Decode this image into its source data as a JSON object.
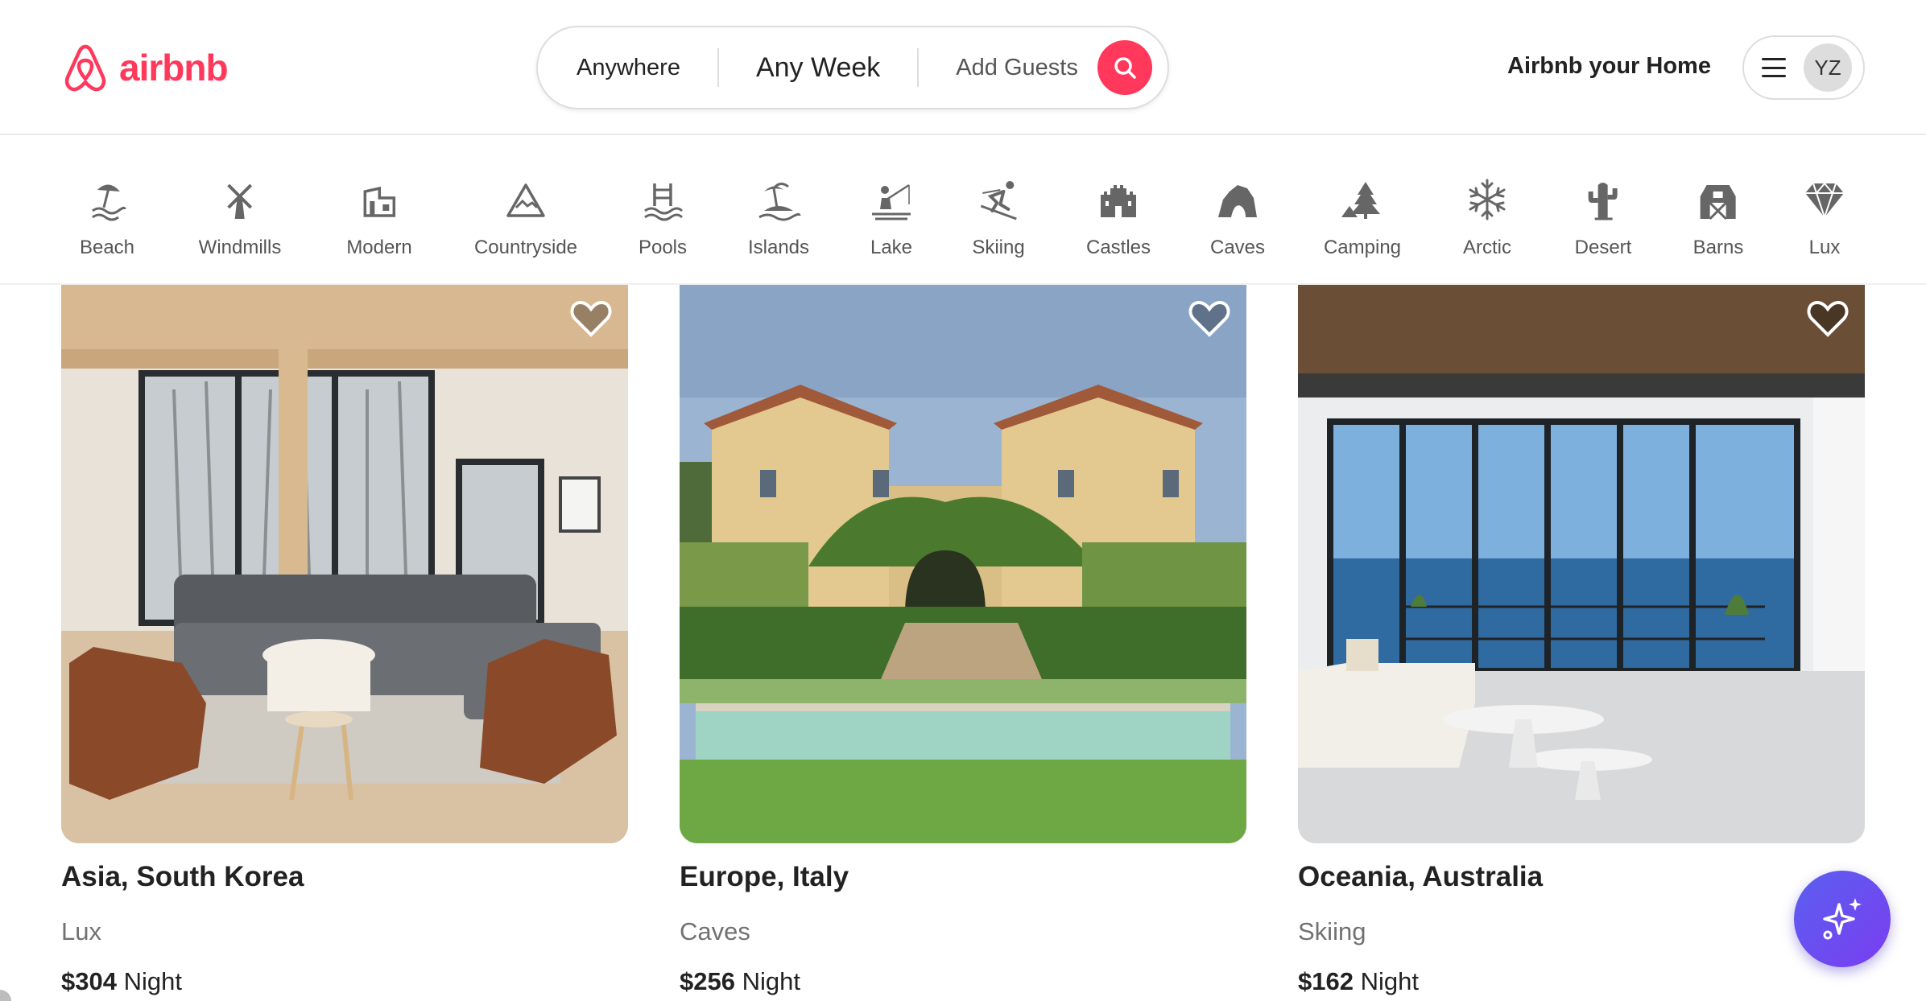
{
  "brand": {
    "name": "airbnb",
    "color": "#ff385c"
  },
  "search": {
    "where": "Anywhere",
    "when": "Any Week",
    "who": "Add Guests",
    "button_icon": "search-icon"
  },
  "header": {
    "host_link": "Airbnb your Home",
    "menu_icon": "hamburger-menu-icon",
    "avatar_initials": "YZ"
  },
  "categories": [
    {
      "label": "Beach",
      "icon": "beach-icon"
    },
    {
      "label": "Windmills",
      "icon": "windmill-icon"
    },
    {
      "label": "Modern",
      "icon": "modern-house-icon"
    },
    {
      "label": "Countryside",
      "icon": "mountain-icon"
    },
    {
      "label": "Pools",
      "icon": "pool-icon"
    },
    {
      "label": "Islands",
      "icon": "island-icon"
    },
    {
      "label": "Lake",
      "icon": "lake-fishing-icon"
    },
    {
      "label": "Skiing",
      "icon": "skier-icon"
    },
    {
      "label": "Castles",
      "icon": "castle-icon"
    },
    {
      "label": "Caves",
      "icon": "cave-icon"
    },
    {
      "label": "Camping",
      "icon": "camping-icon"
    },
    {
      "label": "Arctic",
      "icon": "snowflake-icon"
    },
    {
      "label": "Desert",
      "icon": "cactus-icon"
    },
    {
      "label": "Barns",
      "icon": "barn-icon"
    },
    {
      "label": "Lux",
      "icon": "diamond-icon"
    }
  ],
  "listings": [
    {
      "title": "Asia, South Korea",
      "category": "Lux",
      "price": "$304",
      "unit": "Night"
    },
    {
      "title": "Europe, Italy",
      "category": "Caves",
      "price": "$256",
      "unit": "Night"
    },
    {
      "title": "Oceania, Australia",
      "category": "Skiing",
      "price": "$162",
      "unit": "Night"
    }
  ],
  "assistant_button": {
    "icon": "sparkles-icon"
  }
}
